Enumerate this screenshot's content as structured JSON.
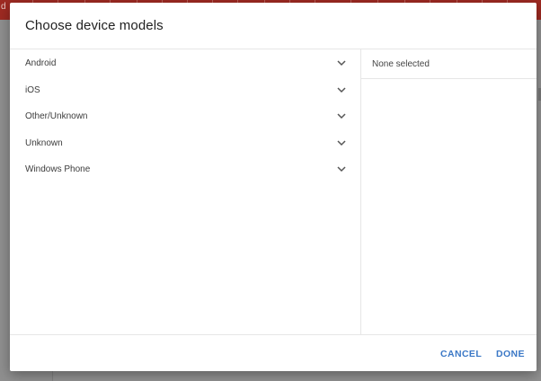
{
  "dialog": {
    "title": "Choose device models",
    "categories": [
      {
        "label": "Android"
      },
      {
        "label": "iOS"
      },
      {
        "label": "Other/Unknown"
      },
      {
        "label": "Unknown"
      },
      {
        "label": "Windows Phone"
      }
    ],
    "selection_summary": "None selected",
    "cancel_label": "CANCEL",
    "done_label": "DONE"
  },
  "background": {
    "topbar_fragment": "d"
  },
  "colors": {
    "accent": "#3b78c6",
    "topbar": "#9e2a22",
    "divider": "#e6e6e6"
  },
  "icons": {
    "category_expand": "chevron-down-icon"
  }
}
